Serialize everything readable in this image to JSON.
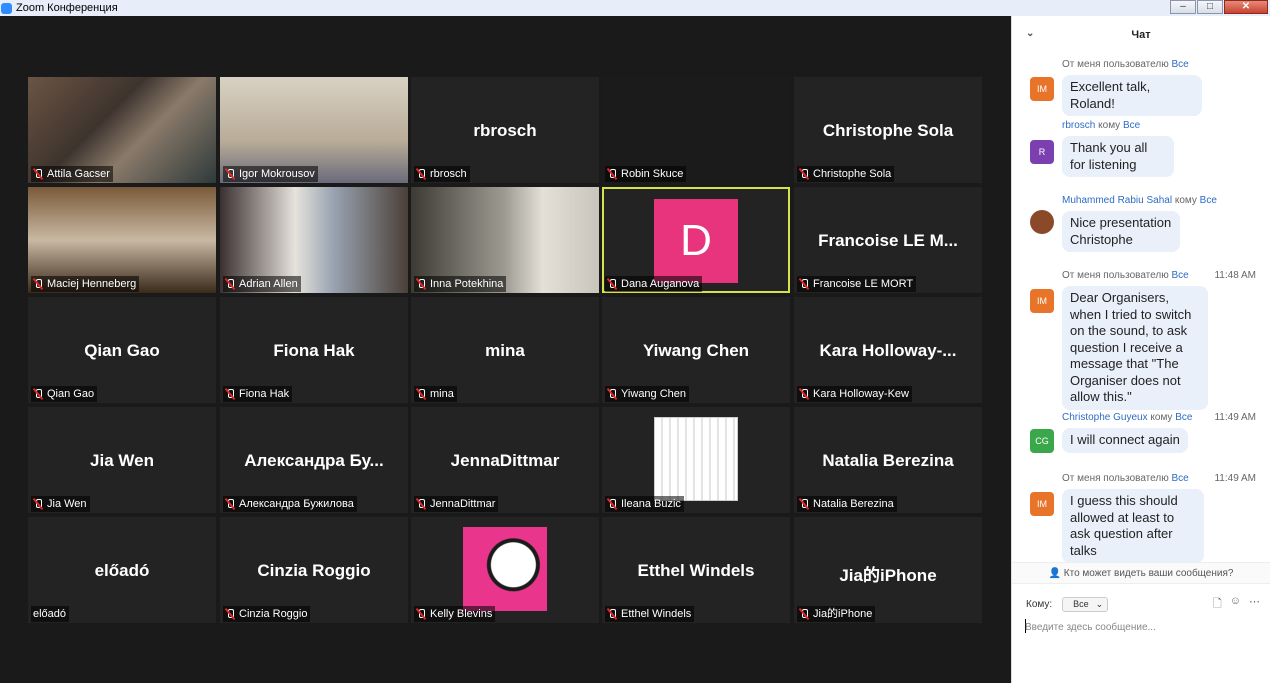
{
  "window": {
    "title": "Zoom Конференция"
  },
  "participants": [
    {
      "label": "Attila Gacser",
      "big": ""
    },
    {
      "label": "Igor Mokrousov",
      "big": ""
    },
    {
      "label": "rbrosch",
      "big": "rbrosch"
    },
    {
      "label": "Robin Skuce",
      "big": ""
    },
    {
      "label": "Christophe Sola",
      "big": "Christophe Sola"
    },
    {
      "label": "Maciej Henneberg",
      "big": ""
    },
    {
      "label": "Adrian Allen",
      "big": ""
    },
    {
      "label": "Inna Potekhina",
      "big": ""
    },
    {
      "label": "Dana Auganova",
      "big": "",
      "avatar_letter": "D",
      "avatar_color": "#e8347c",
      "active_speaker": true
    },
    {
      "label": "Francoise LE MORT",
      "big": "Francoise  LE  M..."
    },
    {
      "label": "Qian Gao",
      "big": "Qian Gao"
    },
    {
      "label": "Fiona Hak",
      "big": "Fiona Hak"
    },
    {
      "label": "mina",
      "big": "mina"
    },
    {
      "label": "Yiwang Chen",
      "big": "Yiwang Chen"
    },
    {
      "label": "Kara Holloway-Kew",
      "big": "Kara  Holloway-..."
    },
    {
      "label": "Jia Wen",
      "big": "Jia Wen"
    },
    {
      "label": "Александра Бужилова",
      "big": "Александра  Бу..."
    },
    {
      "label": "JennaDittmar",
      "big": "JennaDittmar"
    },
    {
      "label": "Ileana Buzic",
      "big": ""
    },
    {
      "label": "Natalia Berezina",
      "big": "Natalia Berezina"
    },
    {
      "label": "előadó",
      "big": "előadó"
    },
    {
      "label": "Cinzia Roggio",
      "big": "Cinzia Roggio"
    },
    {
      "label": "Kelly Blevins",
      "big": ""
    },
    {
      "label": "Etthel Windels",
      "big": "Etthel Windels"
    },
    {
      "label": "Jia的iPhone",
      "big": "Jia的iPhone"
    }
  ],
  "chat": {
    "title": "Чат",
    "messages": [
      {
        "from": "От меня пользователю",
        "to": "Все",
        "time": "",
        "avatar": "IM",
        "avatar_color": "#e8742a",
        "text": "Excellent talk, Roland!"
      },
      {
        "from": "rbrosch",
        "to_word": "кому",
        "to": "Все",
        "time": "",
        "avatar": "R",
        "avatar_color": "#7b3fb0",
        "text": "Thank you all for listening"
      },
      {
        "from": "Muhammed Rabiu Sahal",
        "to_word": "кому",
        "to": "Все",
        "time": "",
        "avatar": "",
        "avatar_color": "#8a4a2a",
        "text": "Nice presentation Christophe"
      },
      {
        "from": "От меня пользователю",
        "to": "Все",
        "time": "11:48 AM",
        "avatar": "IM",
        "avatar_color": "#e8742a",
        "text": "Dear Organisers, when I tried to switch on the sound, to ask question I receive a message that \"The Organiser does not allow this.\""
      },
      {
        "from": "Christophe Guyeux",
        "to_word": "кому",
        "to": "Все",
        "time": "11:49 AM",
        "avatar": "CG",
        "avatar_color": "#3aa84a",
        "text": "I will connect again"
      },
      {
        "from": "От меня пользователю",
        "to": "Все",
        "time": "11:49 AM",
        "avatar": "IM",
        "avatar_color": "#e8742a",
        "text": "I guess this should allowed at least to ask question after talks"
      }
    ],
    "visibility_note": "Кто может видеть ваши сообщения?",
    "to_label": "Кому:",
    "to_value": "Все",
    "input_placeholder": "Введите здесь сообщение..."
  }
}
